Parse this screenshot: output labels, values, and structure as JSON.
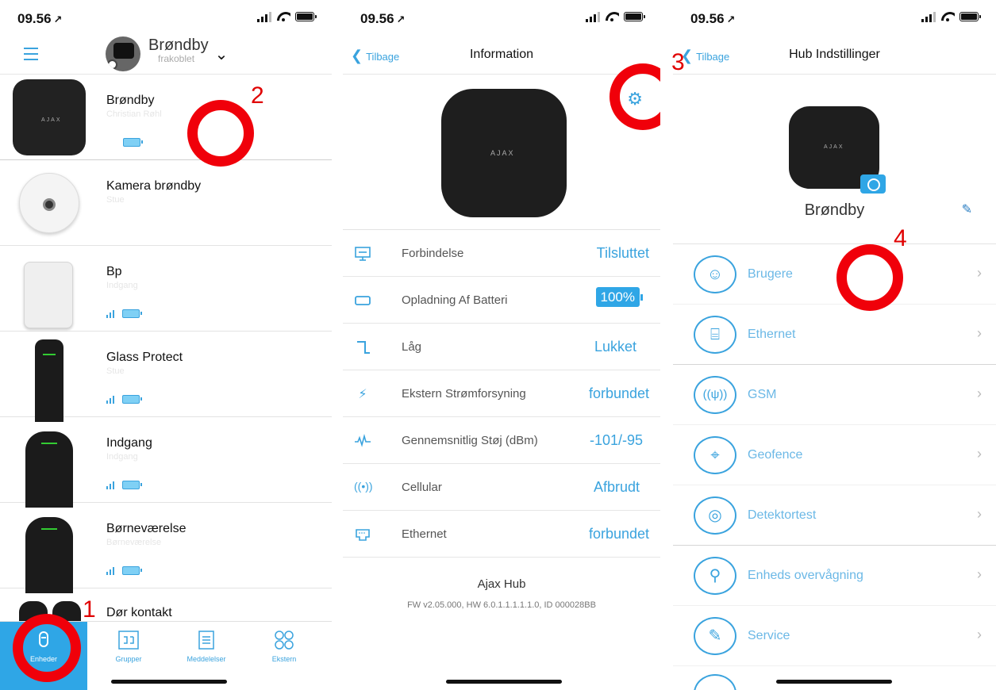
{
  "status": {
    "time": "09.56",
    "location_arrow": "↗"
  },
  "screen1": {
    "hub": {
      "name": "Brøndby",
      "status": "frakoblet"
    },
    "devices": [
      {
        "name": "Brøndby",
        "sub": "Christian Røhl"
      },
      {
        "name": "Kamera brøndby",
        "sub": "Stue"
      },
      {
        "name": "Bp",
        "sub": "Indgang"
      },
      {
        "name": "Glass Protect",
        "sub": "Stue"
      },
      {
        "name": "Indgang",
        "sub": "Indgang"
      },
      {
        "name": "Børneværelse",
        "sub": "Børneværelse"
      },
      {
        "name": "Dør kontakt",
        "sub": ""
      }
    ],
    "tabs": [
      {
        "label": "Enheder"
      },
      {
        "label": "Grupper"
      },
      {
        "label": "Meddelelser"
      },
      {
        "label": "Ekstern"
      }
    ],
    "annotations": [
      "1",
      "2"
    ]
  },
  "screen2": {
    "back_label": "Tilbage",
    "title": "Information",
    "logo": "AJAX",
    "rows": [
      {
        "label": "Forbindelse",
        "value": "Tilsluttet"
      },
      {
        "label": "Opladning Af Batteri",
        "value": "100%"
      },
      {
        "label": "Låg",
        "value": "Lukket"
      },
      {
        "label": "Ekstern Strømforsyning",
        "value": "forbundet"
      },
      {
        "label": "Gennemsnitlig Støj (dBm)",
        "value": "-101/-95"
      },
      {
        "label": "Cellular",
        "value": "Afbrudt"
      },
      {
        "label": "Ethernet",
        "value": "forbundet"
      }
    ],
    "model": "Ajax Hub",
    "firmware": "FW v2.05.000, HW 6.0.1.1.1.1.1.0, ID 000028BB",
    "annotation": "3"
  },
  "screen3": {
    "back_label": "Tilbage",
    "title": "Hub Indstillinger",
    "hub_name": "Brøndby",
    "logo": "AJAX",
    "items": [
      {
        "label": "Brugere"
      },
      {
        "label": "Ethernet"
      },
      {
        "label": "GSM"
      },
      {
        "label": "Geofence"
      },
      {
        "label": "Detektortest"
      },
      {
        "label": "Enheds overvågning"
      },
      {
        "label": "Service"
      }
    ],
    "annotation": "4"
  }
}
